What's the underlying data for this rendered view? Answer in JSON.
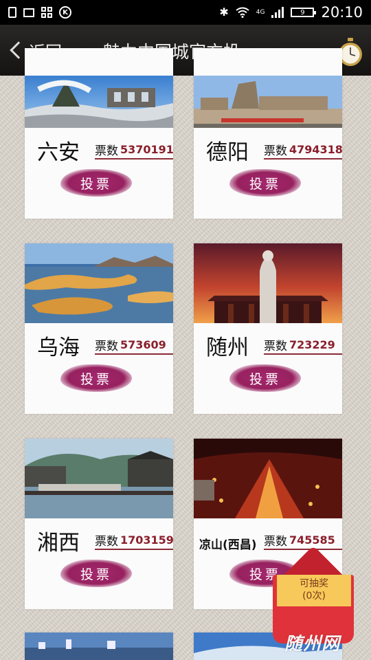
{
  "status_bar": {
    "network": "4G",
    "battery": "9",
    "time": "20:10"
  },
  "header": {
    "back_label": "返回",
    "title": "魅力中国城官方投…"
  },
  "cards": [
    {
      "city": "六安",
      "votes_label": "票数",
      "votes": "5370191",
      "vote_button": "投票",
      "photo": "mountain-ruins-snow"
    },
    {
      "city": "德阳",
      "votes_label": "票数",
      "votes": "4794318",
      "vote_button": "投票",
      "photo": "museum-plaza"
    },
    {
      "city": "乌海",
      "votes_label": "票数",
      "votes": "573609",
      "vote_button": "投票",
      "photo": "desert-lake"
    },
    {
      "city": "随州",
      "votes_label": "票数",
      "votes": "723229",
      "vote_button": "投票",
      "photo": "statue-sunset"
    },
    {
      "city": "湘西",
      "votes_label": "票数",
      "votes": "1703159",
      "vote_button": "投票",
      "photo": "river-town"
    },
    {
      "city": "凉山(西昌)",
      "votes_label": "票数",
      "votes": "745585",
      "vote_button": "投票",
      "photo": "torch-festival"
    }
  ],
  "lottery": {
    "label": "可抽奖",
    "count": "(0次)"
  },
  "watermark": "随州网",
  "colors": {
    "vote_button": "#97215f",
    "vote_number": "#8a1f2c",
    "title_bar": "#1e1c1a"
  }
}
